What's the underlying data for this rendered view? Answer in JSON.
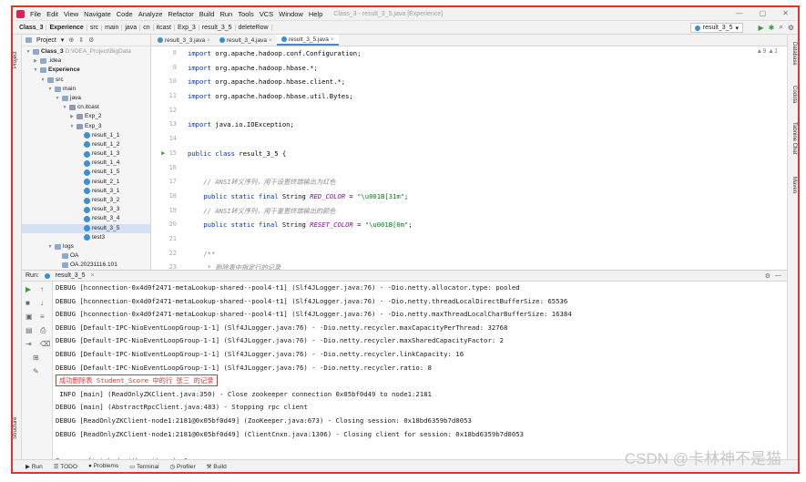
{
  "menubar": {
    "items": [
      "File",
      "Edit",
      "View",
      "Navigate",
      "Code",
      "Analyze",
      "Refactor",
      "Build",
      "Run",
      "Tools",
      "VCS",
      "Window",
      "Help"
    ],
    "title": "Class_3 - result_3_5.java [Experience]"
  },
  "navbar": {
    "crumbs": [
      "Class_3",
      "Experience",
      "src",
      "main",
      "java",
      "cn",
      "itcast",
      "Exp_3",
      "result_3_5",
      "deleteRow"
    ],
    "run_config": "result_3_5"
  },
  "project": {
    "header": "Project",
    "items": [
      {
        "label": "Class_3",
        "extra": "D:\\IDEA_Project\\BigData",
        "type": "folder",
        "indent": 0,
        "arrow": "v"
      },
      {
        "label": ".idea",
        "type": "folder",
        "indent": 1,
        "arrow": ">"
      },
      {
        "label": "Experience",
        "type": "folder",
        "indent": 1,
        "arrow": "v"
      },
      {
        "label": "src",
        "type": "folder",
        "indent": 2,
        "arrow": "v"
      },
      {
        "label": "main",
        "type": "folder",
        "indent": 3,
        "arrow": "v"
      },
      {
        "label": "java",
        "type": "folder",
        "indent": 4,
        "arrow": "v"
      },
      {
        "label": "cn.itcast",
        "type": "pkg",
        "indent": 5,
        "arrow": "v"
      },
      {
        "label": "Exp_2",
        "type": "pkg",
        "indent": 6,
        "arrow": ">"
      },
      {
        "label": "Exp_3",
        "type": "pkg",
        "indent": 6,
        "arrow": "v"
      },
      {
        "label": "result_1_1",
        "type": "class",
        "indent": 7
      },
      {
        "label": "result_1_2",
        "type": "class",
        "indent": 7
      },
      {
        "label": "result_1_3",
        "type": "class",
        "indent": 7
      },
      {
        "label": "result_1_4",
        "type": "class",
        "indent": 7
      },
      {
        "label": "result_1_5",
        "type": "class",
        "indent": 7
      },
      {
        "label": "result_2_1",
        "type": "class",
        "indent": 7
      },
      {
        "label": "result_3_1",
        "type": "class",
        "indent": 7
      },
      {
        "label": "result_3_2",
        "type": "class",
        "indent": 7
      },
      {
        "label": "result_3_3",
        "type": "class",
        "indent": 7
      },
      {
        "label": "result_3_4",
        "type": "class",
        "indent": 7
      },
      {
        "label": "result_3_5",
        "type": "class",
        "indent": 7
      },
      {
        "label": "test3",
        "type": "class",
        "indent": 7
      },
      {
        "label": "logs",
        "type": "folder",
        "indent": 3,
        "arrow": "v"
      },
      {
        "label": "OA",
        "type": "file",
        "indent": 4
      },
      {
        "label": "OA.20231116.101",
        "type": "file",
        "indent": 4
      }
    ]
  },
  "tabs": [
    "result_3_3.java",
    "result_3_4.java",
    "result_3_5.java"
  ],
  "editor": {
    "warnings": "▲9 ▲1",
    "line_numbers": [
      "8",
      "9",
      "10",
      "11",
      "12",
      "13",
      "14",
      "15",
      "16",
      "17",
      "18",
      "19",
      "20",
      "21",
      "22",
      "23",
      "24"
    ],
    "lines": [
      [
        {
          "t": "import ",
          "c": "kw"
        },
        {
          "t": "org.apache.hadoop.conf.Configuration;",
          "c": ""
        }
      ],
      [
        {
          "t": "import ",
          "c": "kw"
        },
        {
          "t": "org.apache.hadoop.hbase.*;",
          "c": ""
        }
      ],
      [
        {
          "t": "import ",
          "c": "kw"
        },
        {
          "t": "org.apache.hadoop.hbase.client.*;",
          "c": ""
        }
      ],
      [
        {
          "t": "import ",
          "c": "kw"
        },
        {
          "t": "org.apache.hadoop.hbase.util.Bytes;",
          "c": ""
        }
      ],
      [],
      [
        {
          "t": "import ",
          "c": "kw"
        },
        {
          "t": "java.io.IOException;",
          "c": ""
        }
      ],
      [],
      [
        {
          "t": "public class ",
          "c": "kw"
        },
        {
          "t": "result_3_5 {",
          "c": ""
        }
      ],
      [],
      [
        {
          "t": "    // ANSI转义序列，用于设置终端输出为红色",
          "c": "cm"
        }
      ],
      [
        {
          "t": "    public static final ",
          "c": "kw"
        },
        {
          "t": "String ",
          "c": ""
        },
        {
          "t": "RED_COLOR",
          "c": "fld"
        },
        {
          "t": " = ",
          "c": ""
        },
        {
          "t": "\"\\u001B[31m\"",
          "c": "str"
        },
        {
          "t": ";",
          "c": ""
        }
      ],
      [
        {
          "t": "    // ANSI转义序列，用于重置终端输出的颜色",
          "c": "cm"
        }
      ],
      [
        {
          "t": "    public static final ",
          "c": "kw"
        },
        {
          "t": "String ",
          "c": ""
        },
        {
          "t": "RESET_COLOR",
          "c": "fld"
        },
        {
          "t": " = ",
          "c": ""
        },
        {
          "t": "\"\\u001B[0m\"",
          "c": "str"
        },
        {
          "t": ";",
          "c": ""
        }
      ],
      [],
      [
        {
          "t": "    /**",
          "c": "cmg"
        }
      ],
      [
        {
          "t": "     * 删除表中指定行的记录",
          "c": "cm"
        }
      ],
      [
        {
          "t": "     *",
          "c": "cmg"
        }
      ]
    ]
  },
  "run": {
    "label": "Run:",
    "tab": "result_3_5"
  },
  "console": {
    "lines": [
      "DEBUG [hconnection-0x4d0f2471-metaLookup-shared--pool4-t1] (Slf4JLogger.java:76) - -Dio.netty.allocator.type: pooled",
      "DEBUG [hconnection-0x4d0f2471-metaLookup-shared--pool4-t1] (Slf4JLogger.java:76) - -Dio.netty.threadLocalDirectBufferSize: 65536",
      "DEBUG [hconnection-0x4d0f2471-metaLookup-shared--pool4-t1] (Slf4JLogger.java:76) - -Dio.netty.maxThreadLocalCharBufferSize: 16384",
      "DEBUG [Default-IPC-NioEventLoopGroup-1-1] (Slf4JLogger.java:76) - -Dio.netty.recycler.maxCapacityPerThread: 32768",
      "DEBUG [Default-IPC-NioEventLoopGroup-1-1] (Slf4JLogger.java:76) - -Dio.netty.recycler.maxSharedCapacityFactor: 2",
      "DEBUG [Default-IPC-NioEventLoopGroup-1-1] (Slf4JLogger.java:76) - -Dio.netty.recycler.linkCapacity: 16",
      "DEBUG [Default-IPC-NioEventLoopGroup-1-1] (Slf4JLogger.java:76) - -Dio.netty.recycler.ratio: 8"
    ],
    "highlight": "成功删除表 Student_Score 中的行 张三 的记录",
    "lines2": [
      " INFO [main] (ReadOnlyZKClient.java:350) - Close zookeeper connection 0x05bf0d49 to node1:2181",
      "DEBUG [main] (AbstractRpcClient.java:483) - Stopping rpc client",
      "DEBUG [ReadOnlyZKClient-node1:2181@0x05bf0d49] (ZooKeeper.java:673) - Closing session: 0x18bd6359b7d0053",
      "DEBUG [ReadOnlyZKClient-node1:2181@0x05bf0d49] (ClientCnxn.java:1306) - Closing client for session: 0x18bd6359b7d0053",
      "",
      "Process finished with exit code 0"
    ]
  },
  "statusbar": [
    "Run",
    "TODO",
    "Problems",
    "Terminal",
    "Profiler",
    "Build"
  ],
  "left_tabs": [
    "Project",
    "Structure",
    "Favorites"
  ],
  "right_tabs": [
    "Database",
    "Codota",
    "Tabnine Chat",
    "Maven"
  ],
  "watermark": "CSDN @卡林神不是猫",
  "colors": {
    "accent": "#e3332b",
    "keyword": "#0033b3",
    "string": "#067d17",
    "field": "#871094"
  }
}
